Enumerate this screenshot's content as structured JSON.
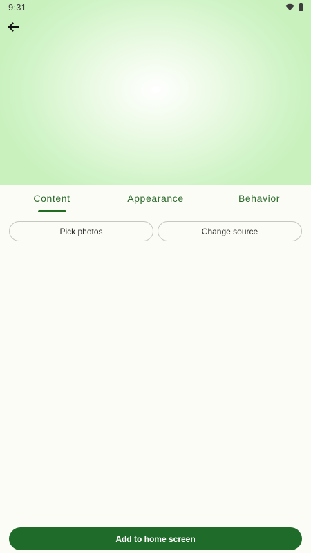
{
  "status_bar": {
    "time": "9:31",
    "icons": [
      "wifi-icon",
      "battery-icon"
    ]
  },
  "header": {
    "back_icon": "arrow-left-icon"
  },
  "tabs": [
    {
      "label": "Content",
      "selected": true
    },
    {
      "label": "Appearance",
      "selected": false
    },
    {
      "label": "Behavior",
      "selected": false
    }
  ],
  "content": {
    "pick_photos_label": "Pick photos",
    "change_source_label": "Change source"
  },
  "footer": {
    "add_label": "Add to home screen"
  },
  "colors": {
    "accent": "#1F6B2A",
    "tab_text": "#2E6A2E",
    "background": "#FBFCF5",
    "hero_tint": "#C9F1BE"
  }
}
